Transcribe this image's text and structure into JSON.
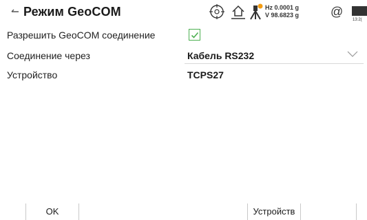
{
  "header": {
    "back_glyph": "⭠",
    "title": "Режим GeoCOM",
    "hz": "Hz 0.0001 g",
    "v": "V  98.6823 g",
    "at_glyph": "@",
    "battery_label": "13:2("
  },
  "form": {
    "allow_label": "Разрешить GeoCOM соединение",
    "allow_checked": true,
    "connection_label": "Соединение через",
    "connection_value": "Кабель RS232",
    "device_label": "Устройство",
    "device_value": "TCPS27"
  },
  "footer": {
    "ok_label": "OK",
    "devices_label": "Устройств"
  },
  "colors": {
    "accent_green": "#4caf50",
    "orange_dot": "#f39c12"
  },
  "icons": [
    "back-arrow-icon",
    "target-icon",
    "home-level-icon",
    "tripod-icon",
    "at-icon",
    "battery-icon",
    "checkmark-icon",
    "chevron-down-icon"
  ]
}
